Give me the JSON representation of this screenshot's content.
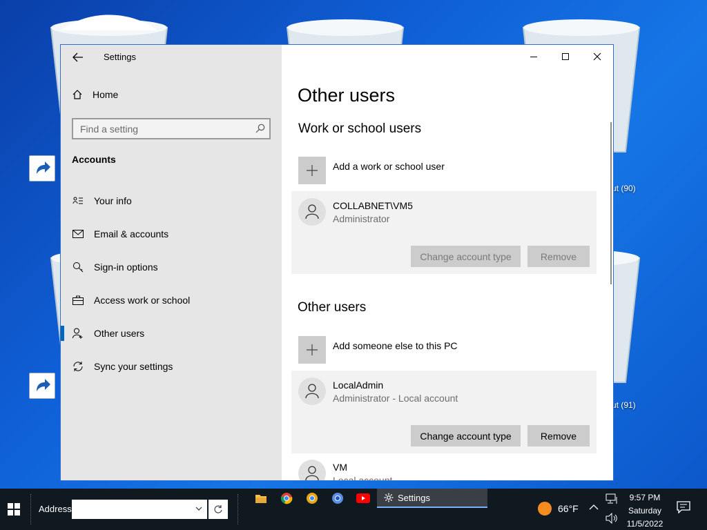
{
  "desktop": {
    "label_1": "ut (90)",
    "label_2": "ut (91)"
  },
  "window": {
    "title": "Settings",
    "controls": {
      "minimize_icon": "minimize-icon",
      "maximize_icon": "maximize-icon",
      "close_icon": "close-icon"
    }
  },
  "sidebar": {
    "home_label": "Home",
    "search_placeholder": "Find a setting",
    "section": "Accounts",
    "items": [
      {
        "label": "Your info",
        "icon": "id-card-icon"
      },
      {
        "label": "Email & accounts",
        "icon": "mail-icon"
      },
      {
        "label": "Sign-in options",
        "icon": "key-icon"
      },
      {
        "label": "Access work or school",
        "icon": "briefcase-icon"
      },
      {
        "label": "Other users",
        "icon": "add-person-icon",
        "active": true
      },
      {
        "label": "Sync your settings",
        "icon": "sync-icon"
      }
    ]
  },
  "content": {
    "page_title": "Other users",
    "work_section": {
      "title": "Work or school users",
      "add_label": "Add a work or school user",
      "users": [
        {
          "name": "COLLABNET\\VM5",
          "role": "Administrator",
          "change_label": "Change account type",
          "remove_label": "Remove"
        }
      ]
    },
    "other_section": {
      "title": "Other users",
      "add_label": "Add someone else to this PC",
      "users": [
        {
          "name": "LocalAdmin",
          "role": "Administrator - Local account",
          "change_label": "Change account type",
          "remove_label": "Remove"
        },
        {
          "name": "VM",
          "role": "Local account"
        }
      ]
    }
  },
  "taskbar": {
    "address_label": "Address",
    "address_value": "",
    "active_task": "Settings",
    "weather_temp": "66°F",
    "time": "9:57 PM",
    "day": "Saturday",
    "date": "11/5/2022"
  },
  "colors": {
    "accent": "#0067c0",
    "sidebar_bg": "#e6e6e6",
    "card_bg": "#f2f2f2",
    "taskbar_bg": "#101820"
  }
}
